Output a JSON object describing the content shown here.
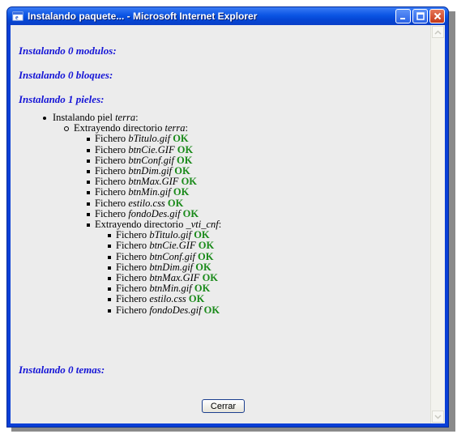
{
  "window": {
    "title": "Instalando paquete... - Microsoft Internet Explorer"
  },
  "headings": {
    "modulos": "Instalando 0 modulos:",
    "bloques": "Instalando 0 bloques:",
    "pieles": "Instalando 1 pieles:",
    "temas": "Instalando 0 temas:"
  },
  "tree": {
    "piel_prefix": "Instalando piel ",
    "piel_name": "terra",
    "piel_suffix": ":",
    "dir_prefix": "Extrayendo directorio ",
    "dir_name": "terra",
    "dir_suffix": ":",
    "files": [
      {
        "label": "Fichero ",
        "name": "bTitulo.gif",
        "status": "OK"
      },
      {
        "label": "Fichero ",
        "name": "btnCie.GIF",
        "status": "OK"
      },
      {
        "label": "Fichero ",
        "name": "btnConf.gif",
        "status": "OK"
      },
      {
        "label": "Fichero ",
        "name": "btnDim.gif",
        "status": "OK"
      },
      {
        "label": "Fichero ",
        "name": "btnMax.GIF",
        "status": "OK"
      },
      {
        "label": "Fichero ",
        "name": "btnMin.gif",
        "status": "OK"
      },
      {
        "label": "Fichero ",
        "name": "estilo.css",
        "status": "OK"
      },
      {
        "label": "Fichero ",
        "name": "fondoDes.gif",
        "status": "OK"
      }
    ],
    "subdir_prefix": "Extrayendo directorio ",
    "subdir_name": "_vti_cnf",
    "subdir_suffix": ":",
    "subfiles": [
      {
        "label": "Fichero ",
        "name": "bTitulo.gif",
        "status": "OK"
      },
      {
        "label": "Fichero ",
        "name": "btnCie.GIF",
        "status": "OK"
      },
      {
        "label": "Fichero ",
        "name": "btnConf.gif",
        "status": "OK"
      },
      {
        "label": "Fichero ",
        "name": "btnDim.gif",
        "status": "OK"
      },
      {
        "label": "Fichero ",
        "name": "btnMax.GIF",
        "status": "OK"
      },
      {
        "label": "Fichero ",
        "name": "btnMin.gif",
        "status": "OK"
      },
      {
        "label": "Fichero ",
        "name": "estilo.css",
        "status": "OK"
      },
      {
        "label": "Fichero ",
        "name": "fondoDes.gif",
        "status": "OK"
      }
    ]
  },
  "buttons": {
    "close_label": "Cerrar"
  },
  "colors": {
    "heading": "#1515d6",
    "ok": "#1a8a1a",
    "titlebar": "#0b55e4"
  },
  "icons": {
    "title": "ie-window-icon",
    "minimize": "minimize-icon",
    "maximize": "maximize-icon",
    "close": "close-icon",
    "scroll_up": "scroll-up-arrow-icon",
    "scroll_down": "scroll-down-arrow-icon"
  }
}
